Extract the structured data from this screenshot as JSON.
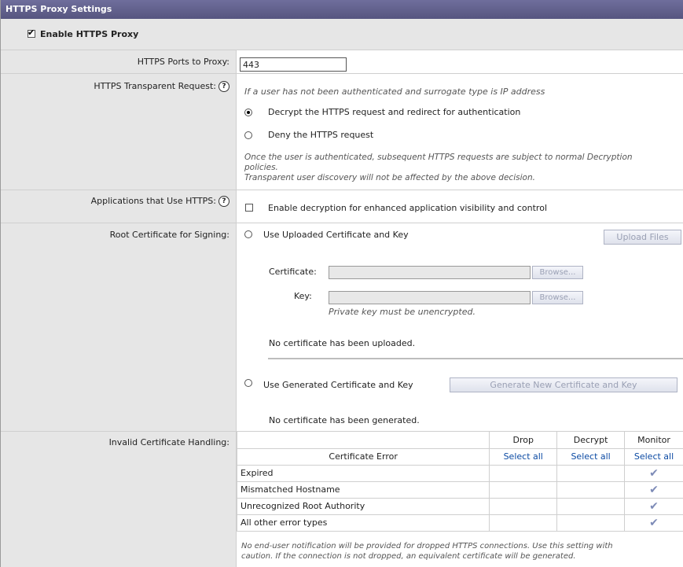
{
  "title": "HTTPS Proxy Settings",
  "enable": {
    "label": "Enable HTTPS Proxy",
    "checked": true
  },
  "ports": {
    "label": "HTTPS Ports to Proxy:",
    "value": "443"
  },
  "transparent": {
    "label": "HTTPS Transparent Request:",
    "help": "?",
    "intro": "If a user has not been authenticated and surrogate type is IP address",
    "option_decrypt": "Decrypt the HTTPS request and redirect for authentication",
    "option_deny": "Deny the HTTPS request",
    "note_line1": "Once the user is authenticated, subsequent HTTPS requests are subject to normal Decryption",
    "note_line2": "policies.",
    "note_line3": "Transparent user discovery will not be affected by the above decision."
  },
  "applications": {
    "label": "Applications that Use HTTPS:",
    "help": "?",
    "option": "Enable decryption for enhanced application visibility and control"
  },
  "root_cert": {
    "label": "Root Certificate for Signing:",
    "use_uploaded": "Use Uploaded Certificate and Key",
    "upload_button": "Upload Files",
    "certificate_label": "Certificate:",
    "key_label": "Key:",
    "browse": "Browse...",
    "key_note": "Private key must be unencrypted.",
    "no_uploaded": "No certificate has been uploaded.",
    "use_generated": "Use Generated Certificate and Key",
    "generate_button": "Generate New Certificate and Key",
    "no_generated": "No certificate has been generated."
  },
  "invalid": {
    "label": "Invalid Certificate Handling:",
    "col_error": "Certificate Error",
    "col_drop": "Drop",
    "col_decrypt": "Decrypt",
    "col_monitor": "Monitor",
    "select_all": "Select all",
    "rows": [
      {
        "error": "Expired",
        "action": "Monitor"
      },
      {
        "error": "Mismatched Hostname",
        "action": "Monitor"
      },
      {
        "error": "Unrecognized Root Authority",
        "action": "Monitor"
      },
      {
        "error": "All other error types",
        "action": "Monitor"
      }
    ],
    "note_line1": "No end-user notification will be provided for dropped HTTPS connections. Use this setting with",
    "note_line2": "caution. If the connection is not dropped, an equivalent certificate will be generated."
  },
  "checkmark": "✔"
}
